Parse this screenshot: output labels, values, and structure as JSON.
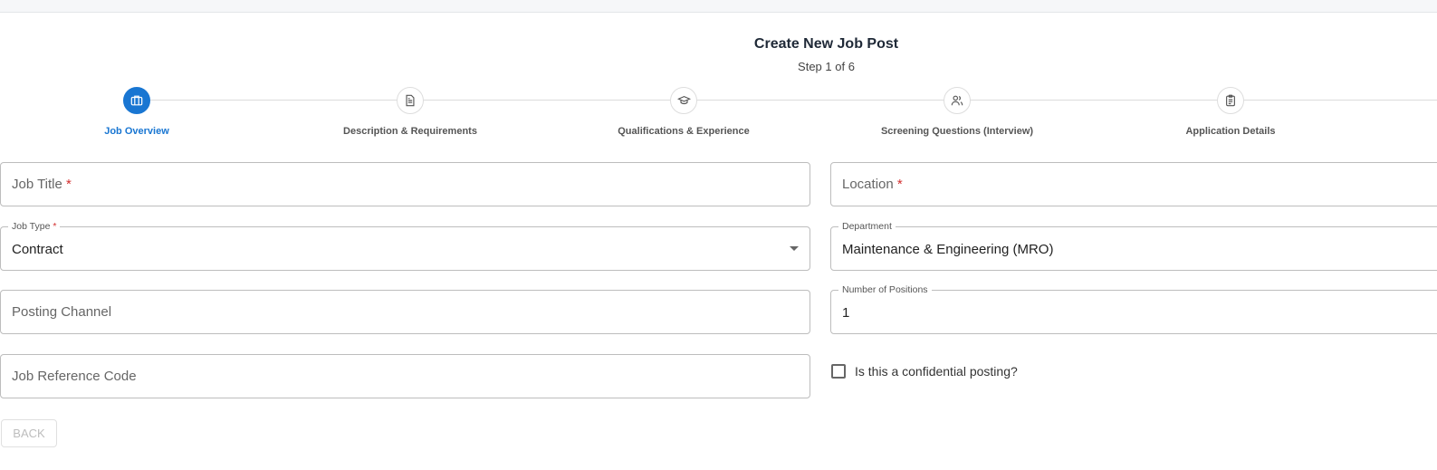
{
  "header": {
    "title": "Create New Job Post",
    "step": "Step 1 of 6"
  },
  "accent": "#1976d2",
  "steps": [
    {
      "label": "Job Overview",
      "icon": "briefcase-icon",
      "active": true
    },
    {
      "label": "Description & Requirements",
      "icon": "document-icon"
    },
    {
      "label": "Qualifications & Experience",
      "icon": "graduation-cap-icon"
    },
    {
      "label": "Screening Questions (Interview)",
      "icon": "users-icon"
    },
    {
      "label": "Application Details",
      "icon": "clipboard-icon"
    }
  ],
  "form": {
    "job_title": {
      "placeholder": "Job Title",
      "required": "*"
    },
    "location": {
      "placeholder": "Location",
      "required": "*"
    },
    "job_type": {
      "label": "Job Type",
      "required": "*",
      "value": "Contract"
    },
    "department": {
      "label": "Department",
      "value": "Maintenance & Engineering (MRO)"
    },
    "posting_channel": {
      "placeholder": "Posting Channel"
    },
    "positions": {
      "label": "Number of Positions",
      "value": "1"
    },
    "reference": {
      "placeholder": "Job Reference Code"
    },
    "confidential": {
      "label": "Is this a confidential posting?",
      "checked": false
    }
  },
  "buttons": {
    "back": "BACK"
  }
}
